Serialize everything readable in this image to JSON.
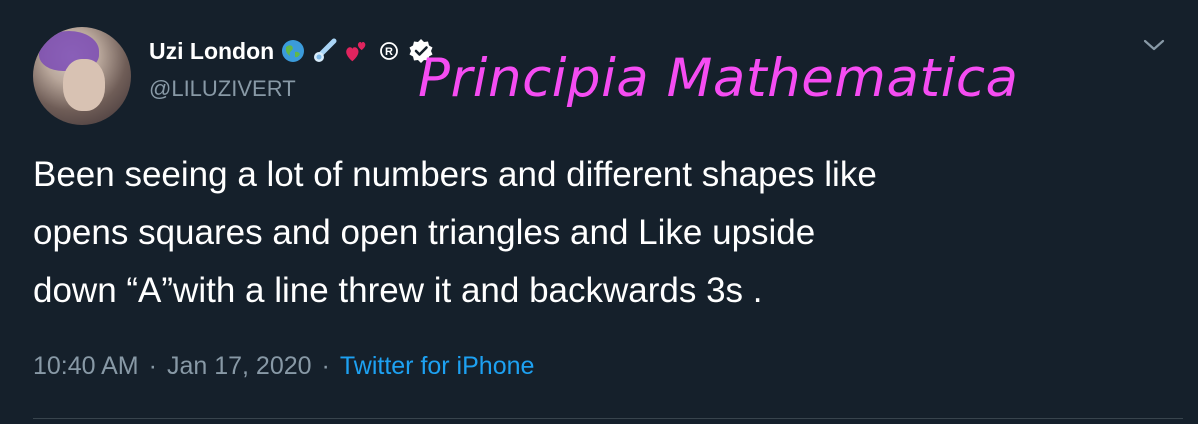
{
  "tweet": {
    "display_name": "Uzi London",
    "handle": "@LILUZIVERT",
    "overlay_title": "Principia Mathematica",
    "text_lines": [
      "Been seeing a lot of numbers and different shapes like",
      "opens squares and open triangles and Like upside",
      "down “A”with a line threw it and backwards 3s  ."
    ],
    "time": "10:40 AM",
    "separator": "·",
    "date": "Jan 17, 2020",
    "source": "Twitter for iPhone",
    "name_emojis": [
      "globe-icon",
      "comet-icon",
      "two-hearts-icon",
      "registered-icon",
      "verified-badge-icon"
    ]
  },
  "colors": {
    "background": "#15202b",
    "text": "#ffffff",
    "secondary_text": "#8899a6",
    "link": "#1da1f2",
    "overlay": "#f54cf2",
    "divider": "#38444d"
  }
}
